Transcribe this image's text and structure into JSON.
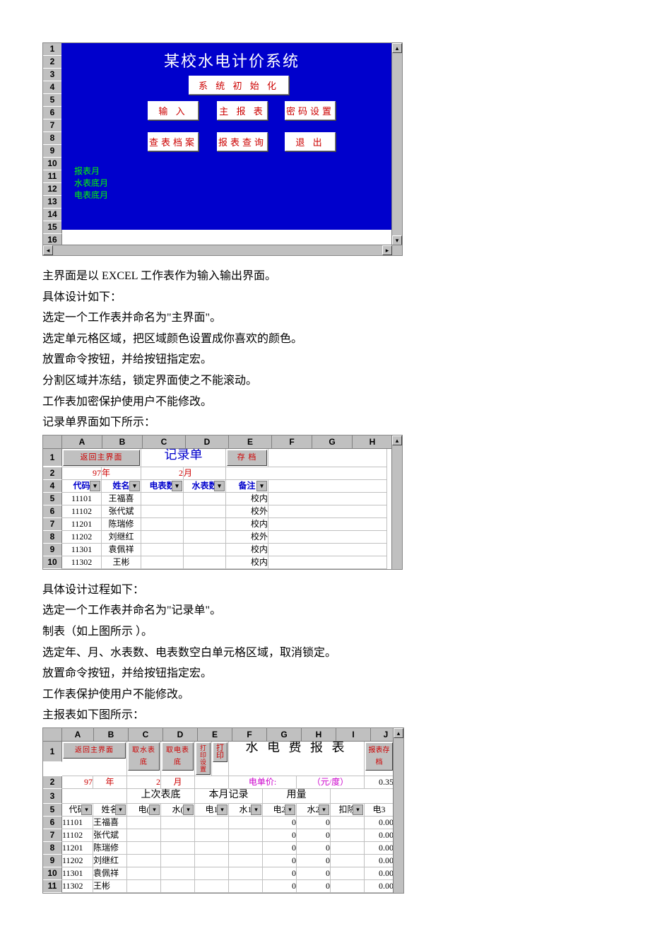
{
  "main": {
    "title": "某校水电计价系统",
    "buttons": {
      "init": "系 统 初 始 化",
      "input": "输  入",
      "report": "主 报 表",
      "password": "密码设置",
      "archive": "查表档案",
      "query": "报表查询",
      "exit": "退  出"
    },
    "labels": {
      "report_month": "报表月",
      "water_base_month": "水表底月",
      "elec_base_month": "电表底月"
    },
    "row_numbers": [
      "1",
      "2",
      "3",
      "4",
      "5",
      "6",
      "7",
      "8",
      "9",
      "10",
      "11",
      "12",
      "13",
      "14",
      "15",
      "16"
    ]
  },
  "text": {
    "p1": "主界面是以 EXCEL 工作表作为输入输出界面。",
    "p2": "具体设计如下：",
    "p3": "选定一个工作表并命名为\"主界面\"。",
    "p4": "选定单元格区域，把区域颜色设置成你喜欢的颜色。",
    "p5": "放置命令按钮，并给按钮指定宏。",
    "p6": "分割区域并冻结，锁定界面使之不能滚动。",
    "p7": "工作表加密保护使用户不能修改。",
    "p8": "记录单界面如下所示：",
    "p9": "具体设计过程如下：",
    "p10": "选定一个工作表并命名为\"记录单\"。",
    "p11": "制表（如上图所示 ）。",
    "p12": "选定年、月、水表数、电表数空白单元格区域，取消锁定。",
    "p13": "放置命令按钮，并给按钮指定宏。",
    "p14": "工作表保护使用户不能修改。",
    "p15": "主报表如下图所示："
  },
  "record": {
    "cols": [
      "A",
      "B",
      "C",
      "D",
      "E",
      "F",
      "G",
      "H"
    ],
    "row_numbers": [
      "1",
      "2",
      "4",
      "5",
      "6",
      "7",
      "8",
      "9",
      "10"
    ],
    "btn_back": "返回主界面",
    "title": "记录单",
    "btn_save": "存 档",
    "year": "97",
    "year_suffix": "年",
    "month": "2",
    "month_suffix": "月",
    "headers": {
      "code": "代码",
      "name": "姓名",
      "elec": "电表数",
      "water": "水表数",
      "remark": "备注"
    },
    "rows": [
      {
        "code": "11101",
        "name": "王福喜",
        "remark": "校内"
      },
      {
        "code": "11102",
        "name": "张代斌",
        "remark": "校外"
      },
      {
        "code": "11201",
        "name": "陈瑞修",
        "remark": "校内"
      },
      {
        "code": "11202",
        "name": "刘继红",
        "remark": "校外"
      },
      {
        "code": "11301",
        "name": "袁佩祥",
        "remark": "校内"
      },
      {
        "code": "11302",
        "name": "王彬",
        "remark": "校内"
      }
    ]
  },
  "report": {
    "cols": [
      "A",
      "B",
      "C",
      "D",
      "E",
      "F",
      "G",
      "H",
      "I",
      "J"
    ],
    "row_numbers": [
      "1",
      "2",
      "3",
      "5",
      "6",
      "7",
      "8",
      "9",
      "10",
      "11"
    ],
    "btn_back": "返回主界面",
    "btn_water": "取水表底",
    "btn_elec": "取电表底",
    "btn_print_setup": "打印设置",
    "btn_print": "打印",
    "title": "水 电 费 报 表",
    "btn_save": "报表存档",
    "year": "97",
    "year_suffix": "年",
    "month": "2",
    "month_suffix": "月",
    "price_label": "电单价:",
    "price_unit": "（元/度）",
    "price_value": "0.35",
    "group_last": "上次表底",
    "group_this": "本月记录",
    "group_usage": "用量",
    "headers": {
      "code": "代码",
      "name": "姓名",
      "e0": "电(",
      "w0": "水(",
      "e1": "电1",
      "w1": "水1",
      "e2": "电2",
      "w2": "水2",
      "deduct": "扣除",
      "e3": "电3"
    },
    "rows": [
      {
        "code": "11101",
        "name": "王福喜",
        "e2": "0",
        "w2": "0",
        "e3": "0.00"
      },
      {
        "code": "11102",
        "name": "张代斌",
        "e2": "0",
        "w2": "0",
        "e3": "0.00"
      },
      {
        "code": "11201",
        "name": "陈瑞修",
        "e2": "0",
        "w2": "0",
        "e3": "0.00"
      },
      {
        "code": "11202",
        "name": "刘继红",
        "e2": "0",
        "w2": "0",
        "e3": "0.00"
      },
      {
        "code": "11301",
        "name": "袁佩祥",
        "e2": "0",
        "w2": "0",
        "e3": "0.00"
      },
      {
        "code": "11302",
        "name": "王彬",
        "e2": "0",
        "w2": "0",
        "e3": "0.00"
      }
    ]
  }
}
